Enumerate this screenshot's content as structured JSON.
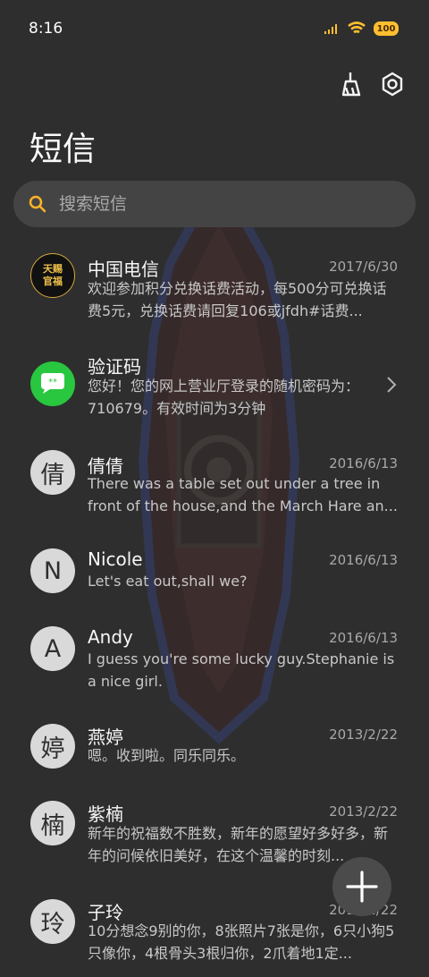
{
  "status": {
    "time": "8:16",
    "battery": "100"
  },
  "title": "短信",
  "search": {
    "placeholder": "搜索短信"
  },
  "messages": [
    {
      "name": "中国电信",
      "date": "2017/6/30",
      "preview": "欢迎参加积分兑换话费活动，每500分可兑换话费5元，兑换话费请回复106或jfdh#话费..."
    },
    {
      "name": "验证码",
      "date": "",
      "preview": "您好！您的网上营业厅登录的随机密码为：710679。有效时间为3分钟"
    },
    {
      "name": "倩倩",
      "avatar": "倩",
      "date": "2016/6/13",
      "preview": "There was a table set out under a tree in front of the house,and the March Hare an..."
    },
    {
      "name": "Nicole",
      "avatar": "N",
      "date": "2016/6/13",
      "preview": "Let's eat out,shall we?"
    },
    {
      "name": "Andy",
      "avatar": "A",
      "date": "2016/6/13",
      "preview": "I guess you're some lucky guy.Stephanie is a nice girl."
    },
    {
      "name": "燕婷",
      "avatar": "婷",
      "date": "2013/2/22",
      "preview": "嗯。收到啦。同乐同乐。"
    },
    {
      "name": "紫楠",
      "avatar": "楠",
      "date": "2013/2/22",
      "preview": "新年的祝福数不胜数，新年的愿望好多好多，新年的问候依旧美好，在这个温馨的时刻..."
    },
    {
      "name": "子玲",
      "avatar": "玲",
      "date": "2013/2/22",
      "preview": "10分想念9别的你，8张照片7张是你，6只小狗5只像你，4根骨头3根归你，2爪着地1定..."
    }
  ],
  "logos": {
    "telecom_text_1": "天赐",
    "telecom_text_2": "官福"
  }
}
